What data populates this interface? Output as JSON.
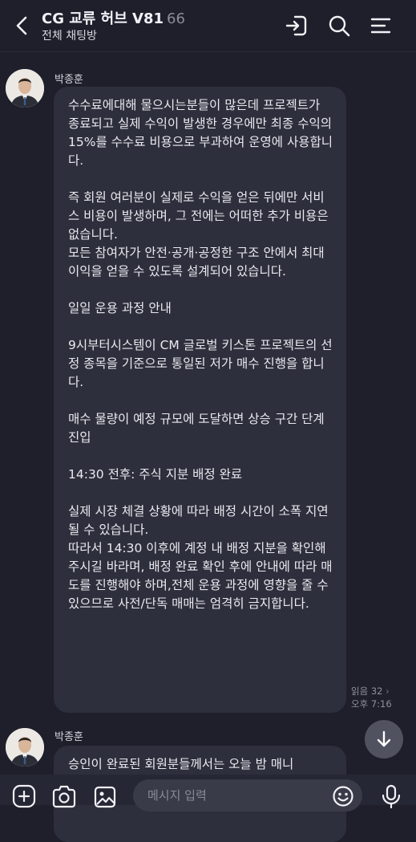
{
  "header": {
    "title": "CG 교류 허브 V81",
    "member_count": "66",
    "subtitle": "전체 채팅방"
  },
  "messages": [
    {
      "sender": "박종훈",
      "text": "수수료에대해 물으시는분들이 많은데 프로젝트가 종료되고 실제 수익이 발생한 경우에만 최종 수익의 15%를 수수료 비용으로 부과하여 운영에 사용합니다.\n\n즉 회원 여러분이 실제로 수익을 얻은 뒤에만 서비스 비용이 발생하며, 그 전에는 어떠한 추가 비용은 없습니다.\n모든 참여자가 안전·공개·공정한 구조 안에서 최대 이익을 얻을 수 있도록 설계되어 있습니다.\n\n일일 운용 과정 안내\n\n9시부터시스템이 CM 글로벌 키스톤 프로젝트의 선정 종목을 기준으로 통일된 저가 매수 진행을 합니다.\n\n매수 물량이 예정 규모에 도달하면 상승 구간 단계 진입\n\n14:30 전후: 주식 지분 배정 완료\n\n실제 시장 체결 상황에 따라 배정 시간이 소폭 지연될 수 있습니다.\n따라서 14:30 이후에 계정 내 배정 지분을 확인해 주시길 바라며, 배정 완료 확인 후에 안내에 따라 매도를 진행해야 하며,전체 운용 과정에 영향을 줄 수 있으므로 사전/단독 매매는 엄격히 금지합니다.",
      "read_label": "읽음 32",
      "time": "오후 7:16"
    },
    {
      "sender": "박종훈",
      "text": "승인이 완료된 회원분들께서는 오늘 밤 매니"
    }
  ],
  "composer": {
    "placeholder": "메시지 입력"
  },
  "colors": {
    "background": "#1e1f2b",
    "bubble": "#2e2f3c",
    "input": "#3a3b48",
    "scroll_button": "#505260"
  }
}
